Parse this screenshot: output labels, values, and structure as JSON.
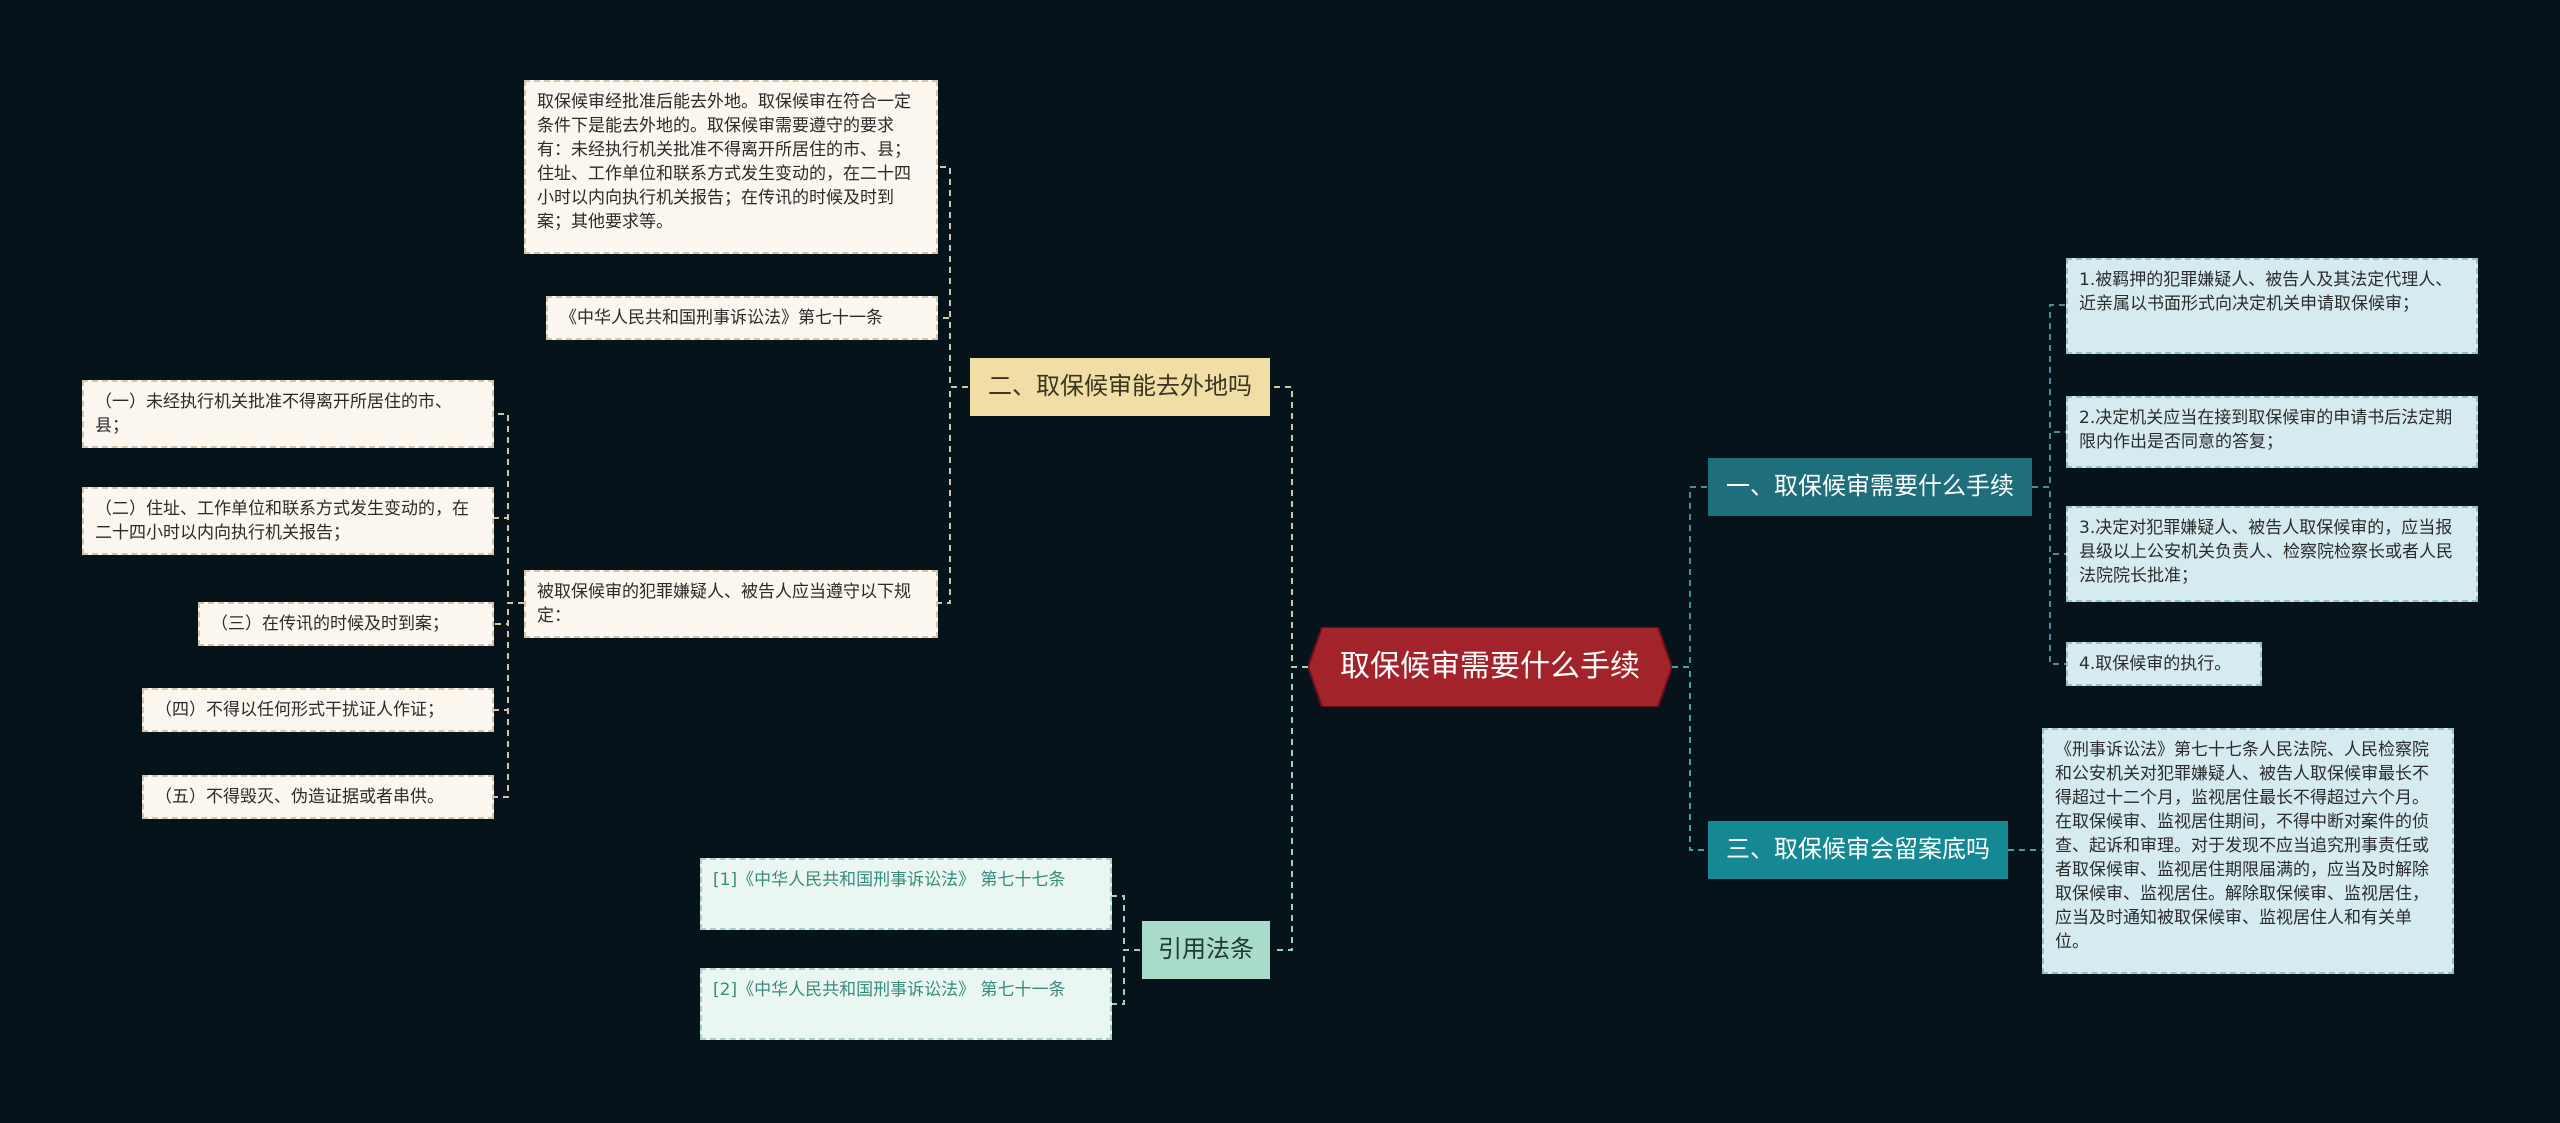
{
  "center": {
    "title": "取保候审需要什么手续"
  },
  "branches": {
    "travel": {
      "label": "二、取保候审能去外地吗",
      "note": "取保候审经批准后能去外地。取保候审在符合一定条件下是能去外地的。取保候审需要遵守的要求有：未经执行机关批准不得离开所居住的市、县；住址、工作单位和联系方式发生变动的，在二十四小时以内向执行机关报告；在传讯的时候及时到案；其他要求等。",
      "law": "《中华人民共和国刑事诉讼法》第七十一条",
      "rules_intro": "被取保候审的犯罪嫌疑人、被告人应当遵守以下规定：",
      "rules": [
        "（一）未经执行机关批准不得离开所居住的市、县；",
        "（二）住址、工作单位和联系方式发生变动的，在二十四小时以内向执行机关报告；",
        "（三）在传讯的时候及时到案；",
        "（四）不得以任何形式干扰证人作证；",
        "（五）不得毁灭、伪造证据或者串供。"
      ]
    },
    "citations": {
      "label": "引用法条",
      "items": [
        "[1]《中华人民共和国刑事诉讼法》 第七十七条",
        "[2]《中华人民共和国刑事诉讼法》 第七十一条"
      ]
    },
    "procedures": {
      "label": "一、取保候审需要什么手续",
      "steps": [
        "1.被羁押的犯罪嫌疑人、被告人及其法定代理人、近亲属以书面形式向决定机关申请取保候审；",
        "2.决定机关应当在接到取保候审的申请书后法定期限内作出是否同意的答复；",
        "3.决定对犯罪嫌疑人、被告人取保候审的，应当报县级以上公安机关负责人、检察院检察长或者人民法院院长批准；",
        "4.取保候审的执行。"
      ]
    },
    "record": {
      "label": "三、取保候审会留案底吗",
      "note": "《刑事诉讼法》第七十七条人民法院、人民检察院和公安机关对犯罪嫌疑人、被告人取保候审最长不得超过十二个月，监视居住最长不得超过六个月。在取保候审、监视居住期间，不得中断对案件的侦查、起诉和审理。对于发现不应当追究刑事责任或者取保候审、监视居住期限届满的，应当及时解除取保候审、监视居住。解除取保候审、监视居住，应当及时通知被取保候审、监视居住人和有关单位。"
    }
  },
  "colors": {
    "background": "#06131b",
    "center": "#a3232a",
    "connector": "#c9c2a6"
  }
}
